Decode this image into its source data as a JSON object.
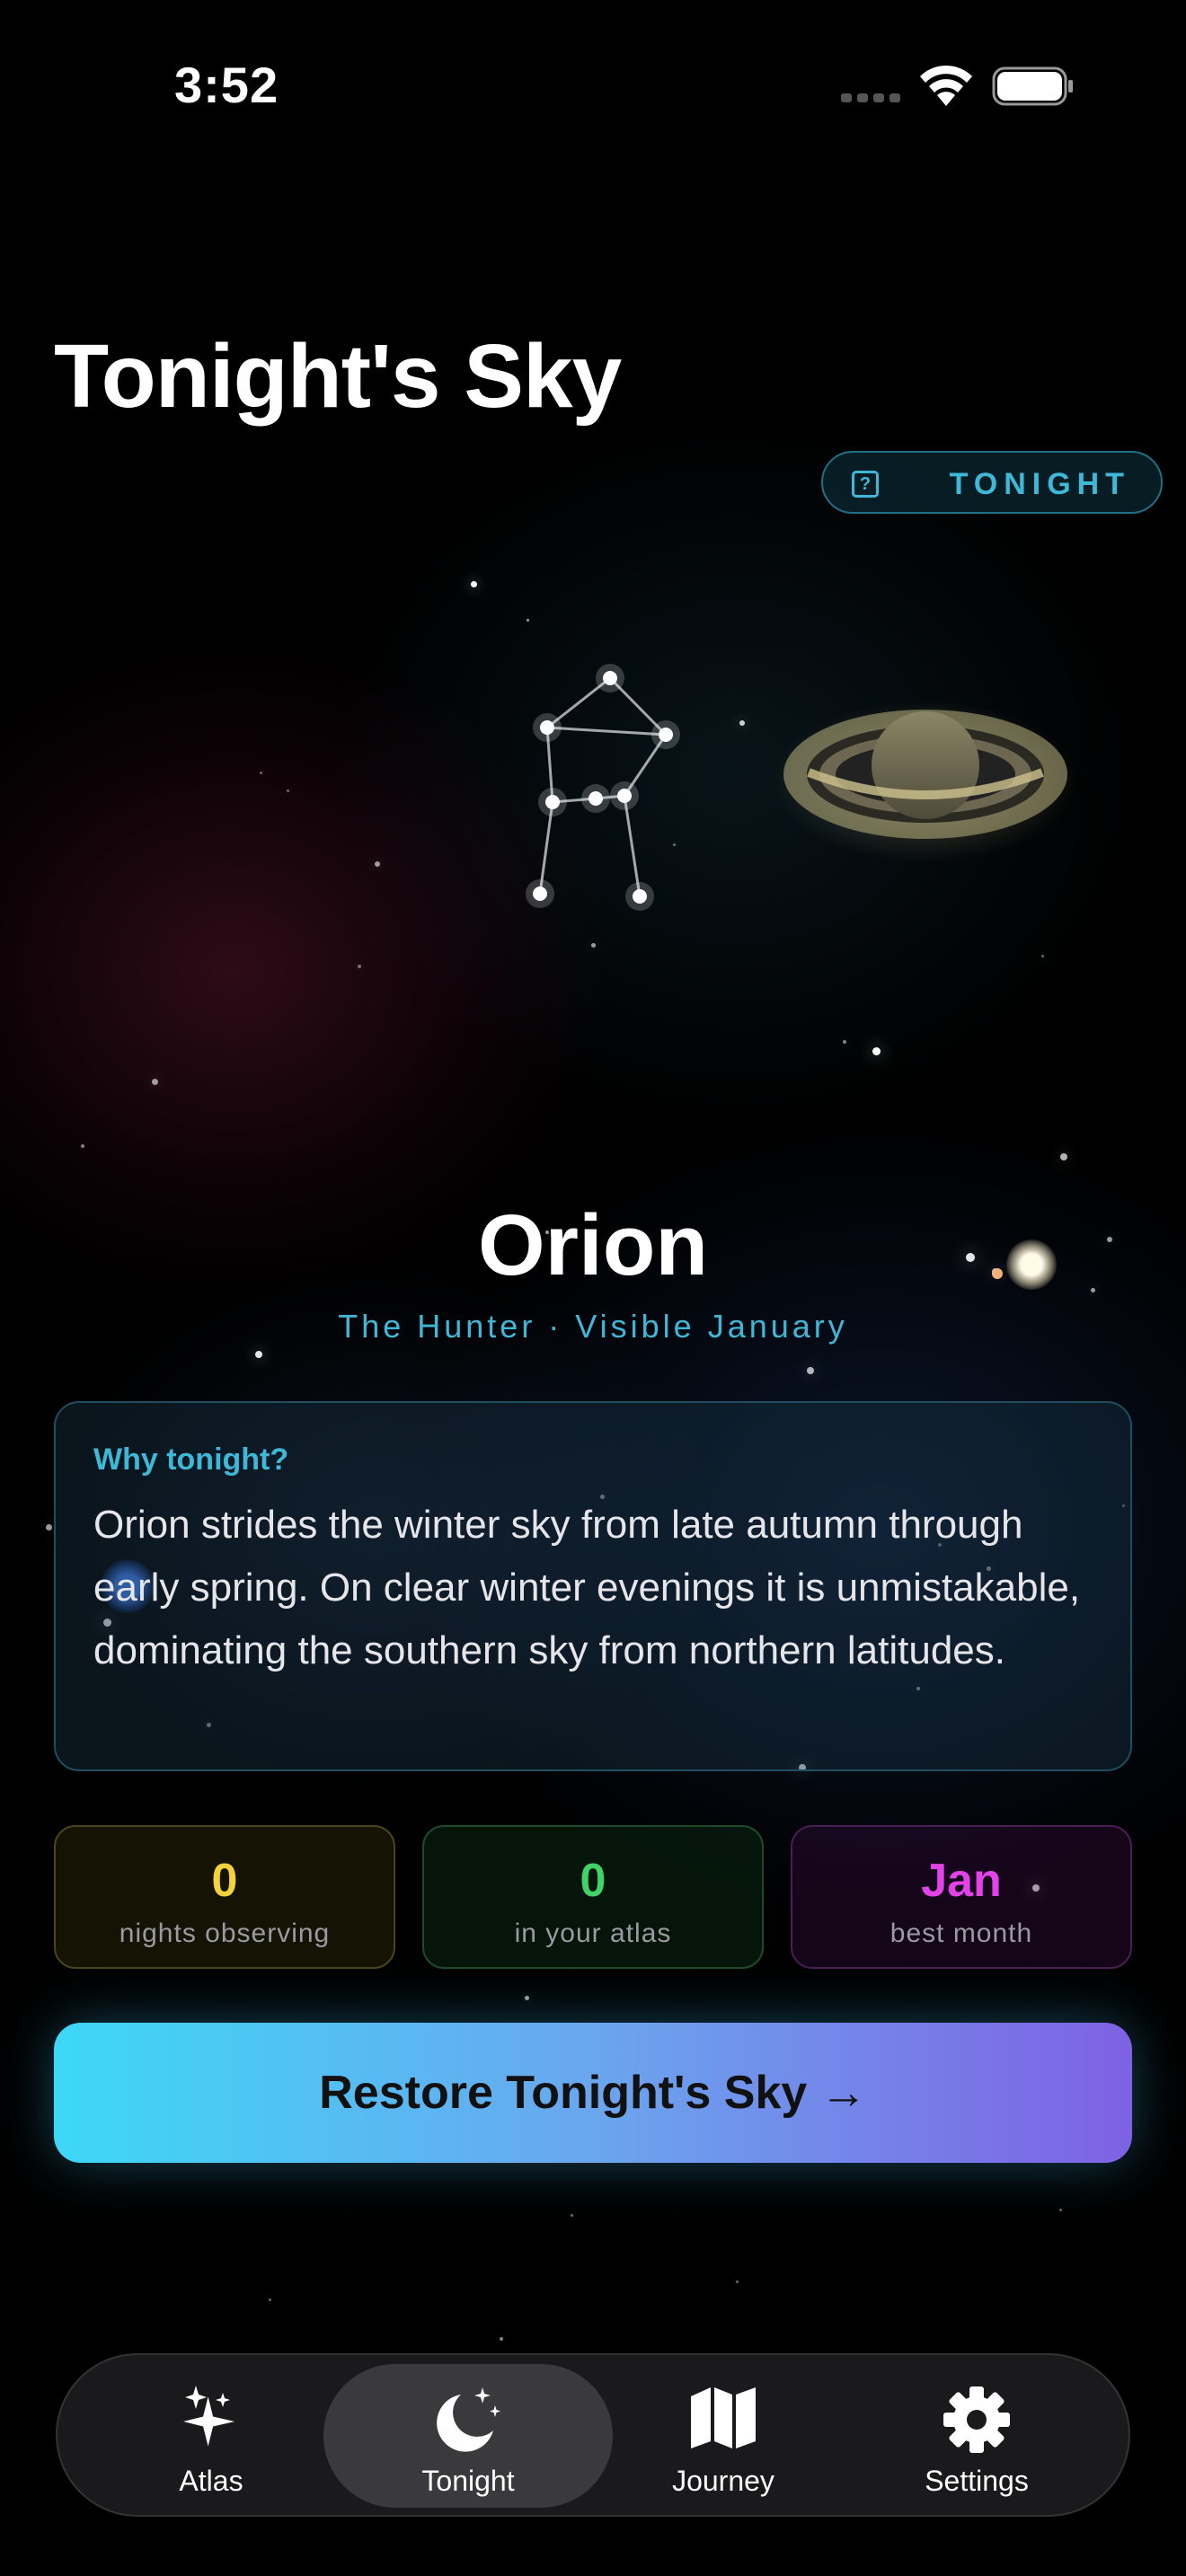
{
  "status_bar": {
    "time": "3:52"
  },
  "header": {
    "title": "Tonight's Sky",
    "pill_label": "TONIGHT"
  },
  "constellation": {
    "name": "Orion",
    "subtitle": "The Hunter · Visible January"
  },
  "why_card": {
    "title": "Why tonight?",
    "body": "Orion strides the winter sky from late autumn through early spring. On clear winter evenings it is unmistakable, dominating the southern sky from northern latitudes."
  },
  "stats": [
    {
      "value": "0",
      "label": "nights observing"
    },
    {
      "value": "0",
      "label": "in your atlas"
    },
    {
      "value": "Jan",
      "label": "best month"
    }
  ],
  "cta": {
    "label": "Restore Tonight's Sky →"
  },
  "tab_bar": {
    "active": "Tonight",
    "items": [
      {
        "label": "Atlas",
        "icon": "sparkles-icon"
      },
      {
        "label": "Tonight",
        "icon": "moon-stars-icon"
      },
      {
        "label": "Journey",
        "icon": "map-icon"
      },
      {
        "label": "Settings",
        "icon": "gear-icon"
      }
    ]
  },
  "colors": {
    "accent_cyan": "#3fb8d8",
    "stat_yellow": "#f4d23c",
    "stat_green": "#3fd36a",
    "stat_magenta": "#e243e8"
  }
}
